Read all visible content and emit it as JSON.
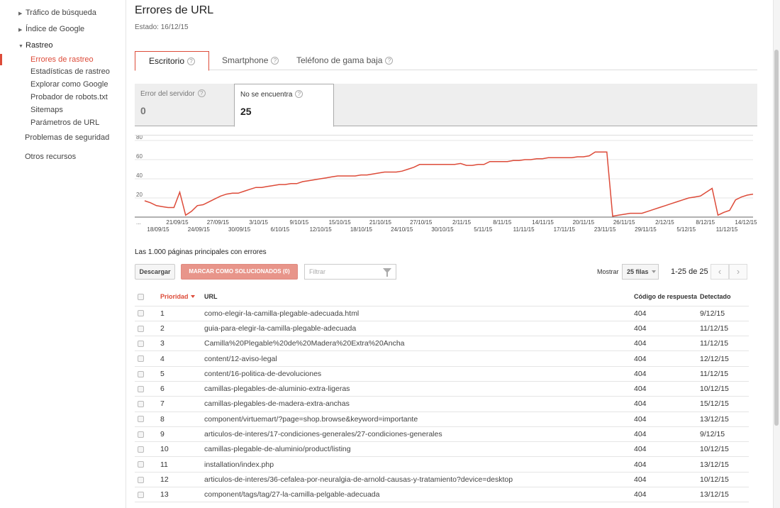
{
  "sidebar": {
    "items": [
      {
        "label": "Tráfico de búsqueda",
        "arrow": "right"
      },
      {
        "label": "Índice de Google",
        "arrow": "right"
      },
      {
        "label": "Rastreo",
        "arrow": "down"
      }
    ],
    "subitems": [
      {
        "label": "Errores de rastreo",
        "active": true
      },
      {
        "label": "Estadísticas de rastreo"
      },
      {
        "label": "Explorar como Google"
      },
      {
        "label": "Probador de robots.txt"
      },
      {
        "label": "Sitemaps"
      },
      {
        "label": "Parámetros de URL"
      }
    ],
    "bottom": [
      {
        "label": "Problemas de seguridad"
      },
      {
        "label": "Otros recursos"
      }
    ]
  },
  "page": {
    "title": "Errores de URL",
    "status": "Estado: 16/12/15"
  },
  "tabs": [
    {
      "label": "Escritorio",
      "active": true
    },
    {
      "label": "Smartphone"
    },
    {
      "label": "Teléfono de gama baja"
    }
  ],
  "metrics": [
    {
      "label": "Error del servidor",
      "value": "0"
    },
    {
      "label": "No se encuentra",
      "value": "25",
      "selected": true
    }
  ],
  "chart_data": {
    "type": "line",
    "color": "#dd4b39",
    "ylim": [
      0,
      80
    ],
    "yticks": [
      "80",
      "60",
      "40",
      "20"
    ],
    "x_labels_top": [
      "21/09/15",
      "27/09/15",
      "3/10/15",
      "9/10/15",
      "15/10/15",
      "21/10/15",
      "27/10/15",
      "2/11/15",
      "8/11/15",
      "14/11/15",
      "20/11/15",
      "26/11/15",
      "2/12/15",
      "8/12/15",
      "14/12/15"
    ],
    "x_labels_bottom": [
      "18/09/15",
      "24/09/15",
      "30/09/15",
      "6/10/15",
      "12/10/15",
      "18/10/15",
      "24/10/15",
      "30/10/15",
      "5/11/15",
      "11/11/15",
      "17/11/15",
      "23/11/15",
      "29/11/15",
      "5/12/15",
      "11/12/15"
    ],
    "values": [
      17,
      15,
      12,
      11,
      10,
      10,
      26,
      2,
      6,
      12,
      13,
      16,
      19,
      22,
      24,
      25,
      25,
      27,
      29,
      31,
      31,
      32,
      33,
      34,
      34,
      35,
      35,
      37,
      38,
      39,
      40,
      41,
      42,
      43,
      43,
      43,
      43,
      44,
      44,
      45,
      46,
      47,
      47,
      47,
      48,
      50,
      52,
      55,
      55,
      55,
      55,
      55,
      55,
      55,
      56,
      54,
      54,
      55,
      55,
      58,
      58,
      58,
      58,
      59,
      59,
      60,
      60,
      61,
      61,
      62,
      62,
      62,
      62,
      62,
      63,
      63,
      64,
      68,
      68,
      68,
      1,
      2,
      3,
      4,
      4,
      4,
      6,
      8,
      10,
      12,
      14,
      16,
      18,
      20,
      21,
      22,
      26,
      30,
      2,
      5,
      7,
      18,
      21,
      23,
      24
    ]
  },
  "list": {
    "subtitle": "Las 1.000 páginas principales con errores",
    "download": "Descargar",
    "mark": "MARCAR COMO SOLUCIONADOS (0)",
    "filter_placeholder": "Filtrar",
    "show_label": "Mostrar",
    "rows_select": "25 filas",
    "pager": "1-25 de 25",
    "columns": [
      "Prioridad",
      "URL",
      "Código de respuesta",
      "Detectado"
    ],
    "rows": [
      {
        "priority": "1",
        "url": "como-elegir-la-camilla-plegable-adecuada.html",
        "code": "404",
        "detected": "9/12/15"
      },
      {
        "priority": "2",
        "url": "guia-para-elegir-la-camilla-plegable-adecuada",
        "code": "404",
        "detected": "11/12/15"
      },
      {
        "priority": "3",
        "url": "Camilla%20Plegable%20de%20Madera%20Extra%20Ancha",
        "code": "404",
        "detected": "11/12/15"
      },
      {
        "priority": "4",
        "url": "content/12-aviso-legal",
        "code": "404",
        "detected": "12/12/15"
      },
      {
        "priority": "5",
        "url": "content/16-politica-de-devoluciones",
        "code": "404",
        "detected": "11/12/15"
      },
      {
        "priority": "6",
        "url": "camillas-plegables-de-aluminio-extra-ligeras",
        "code": "404",
        "detected": "10/12/15"
      },
      {
        "priority": "7",
        "url": "camillas-plegables-de-madera-extra-anchas",
        "code": "404",
        "detected": "15/12/15"
      },
      {
        "priority": "8",
        "url": "component/virtuemart/?page=shop.browse&keyword=importante",
        "code": "404",
        "detected": "13/12/15"
      },
      {
        "priority": "9",
        "url": "articulos-de-interes/17-condiciones-generales/27-condiciones-generales",
        "code": "404",
        "detected": "9/12/15"
      },
      {
        "priority": "10",
        "url": "camillas-plegable-de-aluminio/product/listing",
        "code": "404",
        "detected": "10/12/15"
      },
      {
        "priority": "11",
        "url": "installation/index.php",
        "code": "404",
        "detected": "13/12/15"
      },
      {
        "priority": "12",
        "url": "articulos-de-interes/36-cefalea-por-neuralgia-de-arnold-causas-y-tratamiento?device=desktop",
        "code": "404",
        "detected": "10/12/15"
      },
      {
        "priority": "13",
        "url": "component/tags/tag/27-la-camilla-pelgable-adecuada",
        "code": "404",
        "detected": "13/12/15"
      }
    ]
  }
}
